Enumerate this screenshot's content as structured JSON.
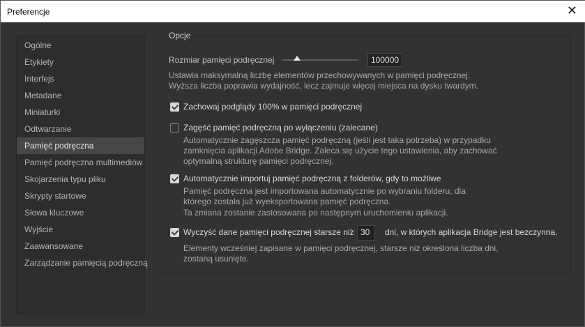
{
  "window": {
    "title": "Preferencje",
    "close": "✕"
  },
  "sidebar": {
    "items": [
      "Ogólne",
      "Etykiety",
      "Interfejs",
      "Metadane",
      "Miniaturki",
      "Odtwarzanie",
      "Pamięć podręczna",
      "Pamięć podręczna multimediów",
      "Skojarzenia typu pliku",
      "Skrypty startowe",
      "Słowa kluczowe",
      "Wyjście",
      "Zaawansowane",
      "Zarządzanie pamięcią podręczną"
    ],
    "selected": 6
  },
  "options": {
    "legend": "Opcje",
    "cache_size_label": "Rozmiar pamięci podręcznej",
    "cache_size_value": "100000",
    "cache_size_slider_fraction": 0.2,
    "cache_size_desc1": "Ustawia maksymalną liczbę elementów przechowywanych w pamięci podręcznej.",
    "cache_size_desc2": "Wyższa liczba poprawia wydajność, lecz zajmuje więcej miejsca na dysku twardym.",
    "keep_previews": {
      "label": "Zachowaj podglądy 100% w pamięci podręcznej",
      "checked": true
    },
    "compact": {
      "label": "Zagęść pamięć podręczną po wyłączeniu (zalecane)",
      "checked": false,
      "desc1": "Automatycznie zagęszcza pamięć podręczną (jeśli jest taka potrzeba) w przypadku",
      "desc2": "zamknięcia aplikacji Adobe Bridge. Zaleca się użycie tego ustawienia, aby zachować",
      "desc3": "optymalną strukturę pamięci podręcznej."
    },
    "auto_import": {
      "label": "Automatycznie importuj pamięć podręczną z folderów, gdy to możliwe",
      "checked": true,
      "desc1": "Pamięć podręczna jest importowana automatycznie po wybraniu folderu, dla",
      "desc2": "którego została już wyeksportowana pamięć podręczna.",
      "desc3": "Ta zmiana zostanie zastosowana po następnym uruchomieniu aplikacji."
    },
    "purge": {
      "label": "Wyczyść dane pamięci podręcznej starsze niż",
      "days": "30",
      "suffix": "dni, w których aplikacja Bridge jest bezczynna.",
      "checked": true,
      "desc1": "Elementy wcześniej zapisane w pamięci podręcznej, starsze niż określona liczba dni,",
      "desc2": "zostaną usunięte."
    }
  }
}
